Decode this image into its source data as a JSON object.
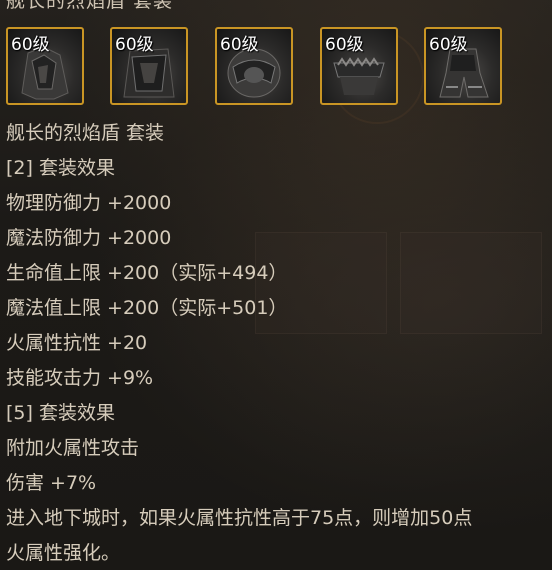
{
  "tooltip": {
    "partial_title": "舰长的烈焰盾 套装",
    "slots": [
      {
        "level": "60级",
        "icon": "armor-piece-icon"
      },
      {
        "level": "60级",
        "icon": "armor-piece-icon"
      },
      {
        "level": "60级",
        "icon": "armor-piece-icon"
      },
      {
        "level": "60级",
        "icon": "armor-piece-icon"
      },
      {
        "level": "60级",
        "icon": "armor-piece-icon"
      }
    ],
    "lines": [
      "舰长的烈焰盾 套装",
      "[2] 套装效果",
      "物理防御力 +2000",
      "魔法防御力 +2000",
      "生命值上限 +200（实际+494）",
      "魔法值上限 +200（实际+501）",
      "火属性抗性 +20",
      "技能攻击力 +9%",
      "[5] 套装效果",
      "附加火属性攻击",
      "伤害 +7%",
      "进入地下城时，如果火属性抗性高于75点，则增加50点",
      "火属性强化。"
    ]
  },
  "colors": {
    "text": "#d6ccbb",
    "slot_border": "#c99524",
    "background": "#1c1a17"
  }
}
